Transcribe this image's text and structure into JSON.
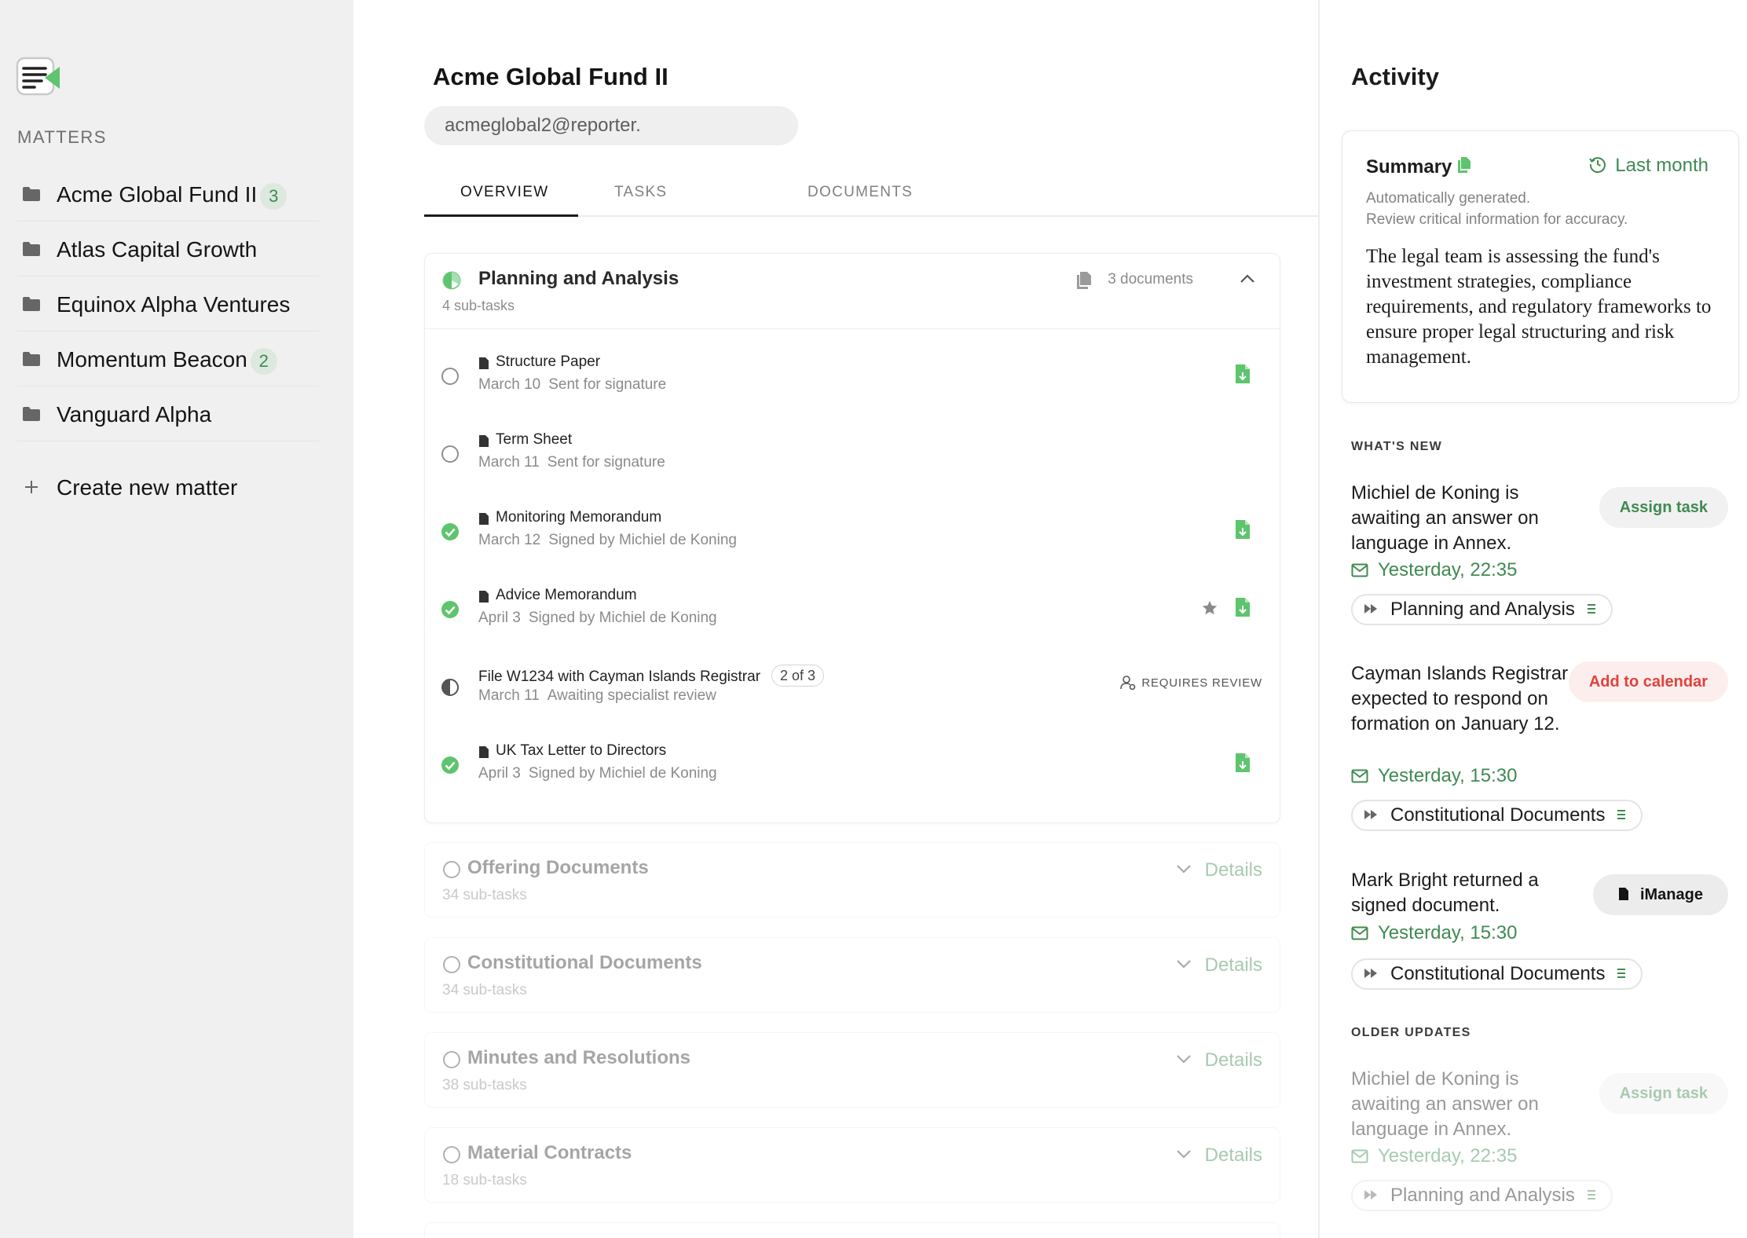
{
  "sidebar": {
    "heading": "MATTERS",
    "matters": [
      {
        "name": "Acme Global Fund II",
        "badge": "3"
      },
      {
        "name": "Atlas Capital Growth",
        "badge": ""
      },
      {
        "name": "Equinox Alpha Ventures",
        "badge": ""
      },
      {
        "name": "Momentum Beacon",
        "badge": "2"
      },
      {
        "name": "Vanguard Alpha",
        "badge": ""
      }
    ],
    "create_label": "Create new matter"
  },
  "main": {
    "title": "Acme Global Fund II",
    "email": "acmeglobal2@reporter.",
    "tabs": [
      "OVERVIEW",
      "TASKS",
      "DOCUMENTS"
    ],
    "active_tab": "OVERVIEW",
    "phase": {
      "title": "Planning and Analysis",
      "subtasks": "4 sub-tasks",
      "documents": "3 documents",
      "progress": 0.5,
      "tasks": [
        {
          "name": "Structure Paper",
          "date": "March 10",
          "status_text": "Sent for signature",
          "done": false
        },
        {
          "name": "Term Sheet",
          "date": "March 11",
          "status_text": "Sent for signature",
          "done": false
        },
        {
          "name": "Monitoring Memorandum",
          "date": "March 12",
          "status_text": "Signed by Michiel de Koning",
          "done": true
        },
        {
          "name": "Advice Memorandum",
          "date": "April 3",
          "status_text": "Signed by Michiel de Koning",
          "done": true
        },
        {
          "name": "File W1234 with Cayman Islands Registrar",
          "date": "March 11",
          "status_text": "Awaiting specialist review",
          "step": "2 of 3",
          "review_label": "REQUIRES REVIEW",
          "done": false
        },
        {
          "name": "UK Tax Letter to Directors",
          "date": "April 3",
          "status_text": "Signed by Michiel de Koning",
          "done": true
        }
      ]
    },
    "collapsed_phases": [
      {
        "title": "Offering Documents",
        "subtasks": "34 sub-tasks",
        "details": "Details"
      },
      {
        "title": "Constitutional Documents",
        "subtasks": "34 sub-tasks",
        "details": "Details"
      },
      {
        "title": "Minutes and Resolutions",
        "subtasks": "38 sub-tasks",
        "details": "Details"
      },
      {
        "title": "Material Contracts",
        "subtasks": "18 sub-tasks",
        "details": "Details"
      }
    ]
  },
  "activity": {
    "title": "Activity",
    "summary": {
      "title": "Summary",
      "period": "Last month",
      "note_line1": "Automatically generated.",
      "note_line2": "Review critical information for accuracy.",
      "text": "The legal team is assessing the fund's investment strategies, compliance requirements, and regulatory frameworks to ensure proper legal structuring and risk management."
    },
    "whats_new_heading": "WHAT'S NEW",
    "older_heading": "OLDER UPDATES",
    "items": [
      {
        "text": "Michiel de Koning is awaiting an answer on language in Annex.",
        "time": "Yesterday, 22:35",
        "action": "Assign task",
        "chip": "Planning and Analysis"
      },
      {
        "text": "Cayman Islands Registrar expected to respond on formation on January 12.",
        "time": "Yesterday, 15:30",
        "action": "Add to calendar",
        "chip": "Constitutional Documents"
      },
      {
        "text": "Mark Bright returned a signed document.",
        "time": "Yesterday, 15:30",
        "action": "iManage",
        "chip": "Constitutional Documents"
      }
    ],
    "older_items": [
      {
        "text": "Michiel de Koning is awaiting an answer on language in Annex.",
        "time": "Yesterday, 22:35",
        "action": "Assign task",
        "chip": "Planning and Analysis"
      }
    ]
  },
  "colors": {
    "accent": "#3f8a52",
    "alert": "#e0423a",
    "sidebar_bg": "#f0f0f0"
  },
  "icons": [
    "logo-icon",
    "folder-icon",
    "plus-icon",
    "half-progress-icon",
    "documents-icon",
    "chevron-up-icon",
    "chevron-down-icon",
    "empty-circle-icon",
    "check-circle-icon",
    "file-icon",
    "green-document-icon",
    "star-icon",
    "user-review-icon",
    "history-clock-icon",
    "mail-icon",
    "fast-forward-icon",
    "menu-lines-icon"
  ]
}
